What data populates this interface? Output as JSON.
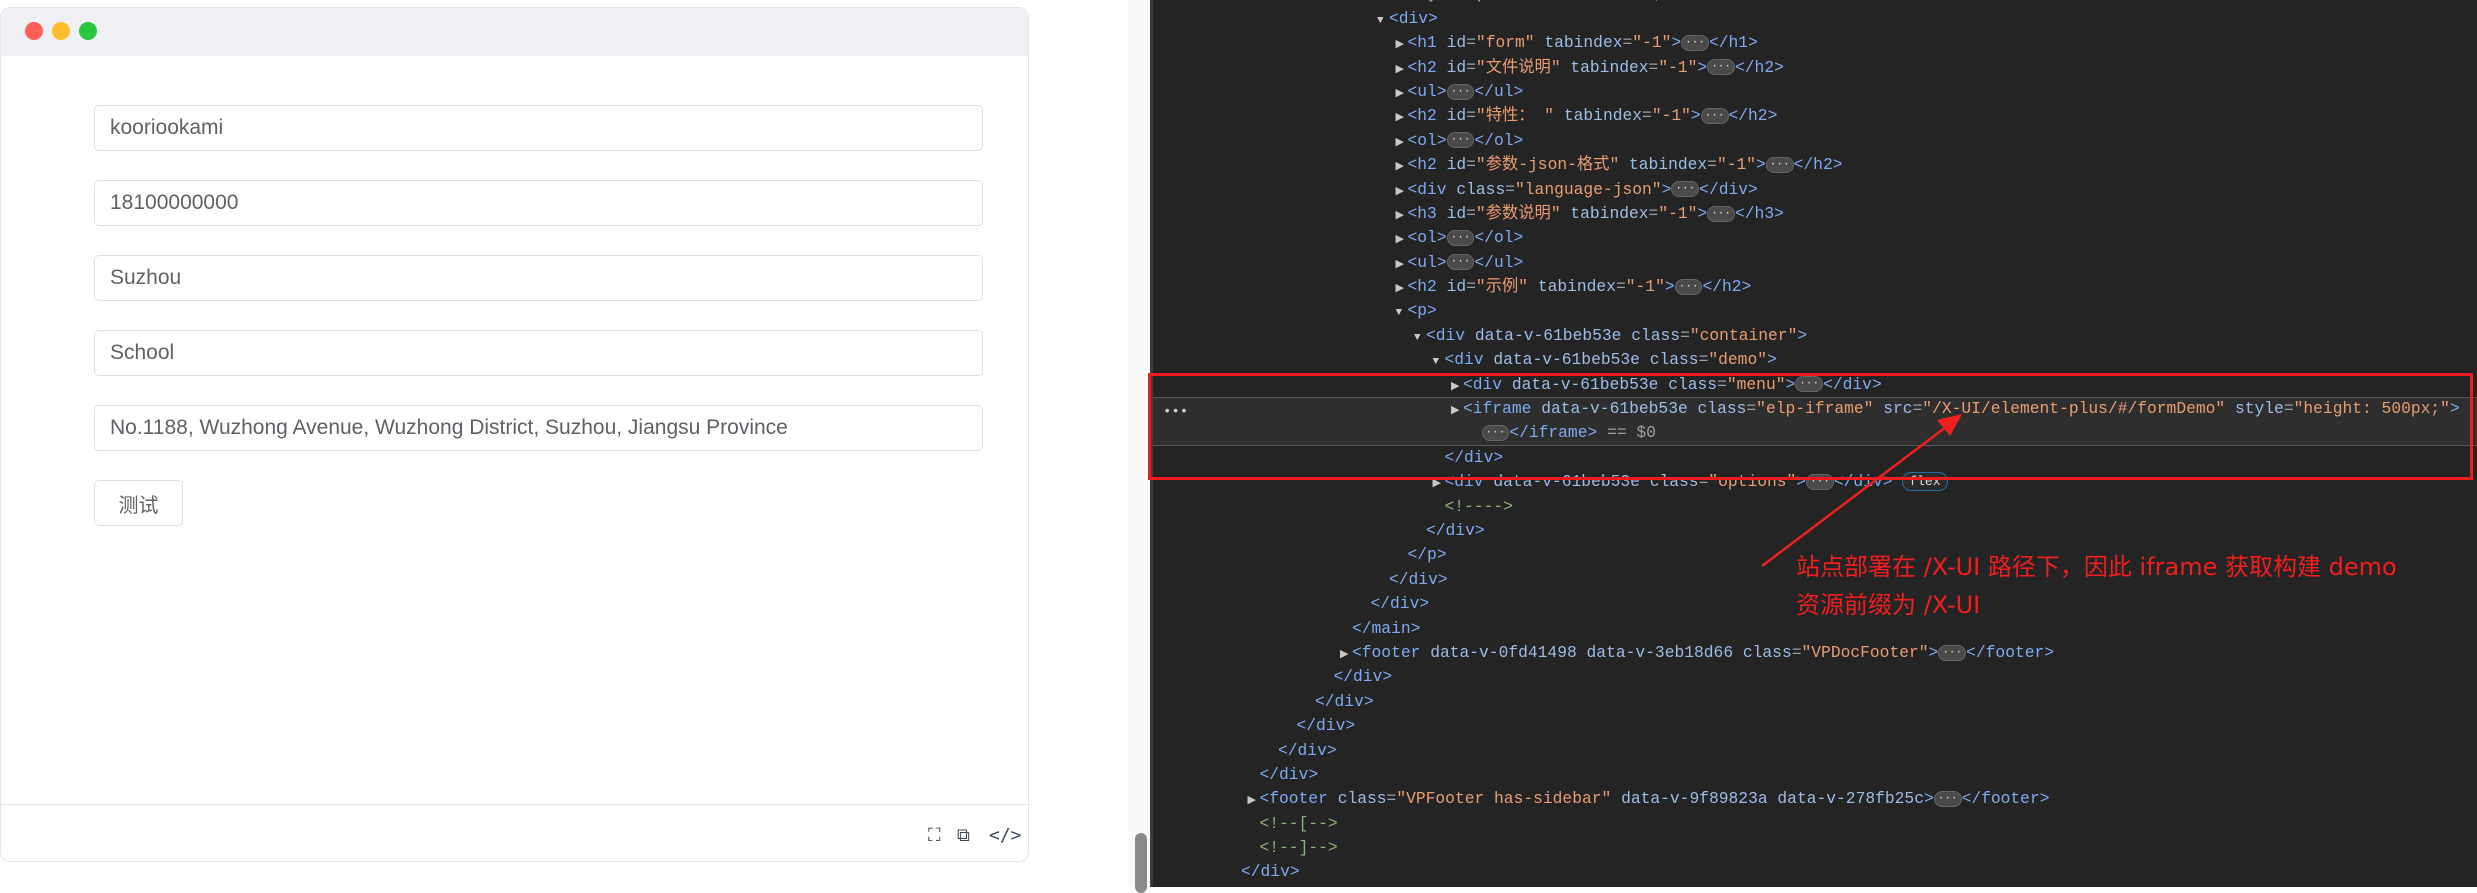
{
  "window": {
    "traffic_lights": [
      "#ff5f57",
      "#febc2e",
      "#28c840"
    ]
  },
  "form": {
    "fields": [
      {
        "value": "kooriookami"
      },
      {
        "value": "18100000000"
      },
      {
        "value": "Suzhou"
      },
      {
        "value": "School"
      },
      {
        "value": "No.1188, Wuzhong Avenue, Wuzhong District, Suzhou, Jiangsu Province"
      }
    ],
    "submit_label": "测试"
  },
  "demo_footer": {
    "icons": [
      "fullscreen-icon",
      "copy-icon",
      "code-icon"
    ],
    "code_label": "</>"
  },
  "devtools": {
    "selected_line_suffix": "== $0",
    "lines": [
      {
        "depth": 8,
        "arrow": "",
        "text": "<  style=\"position: relative;\">"
      },
      {
        "depth": 8,
        "arrow": "down",
        "text": "<div>"
      },
      {
        "depth": 9,
        "arrow": "right",
        "text": "<h1 id=\"form\" tabindex=\"-1\">⋯</h1>"
      },
      {
        "depth": 9,
        "arrow": "right",
        "text": "<h2 id=\"文件说明\" tabindex=\"-1\">⋯</h2>"
      },
      {
        "depth": 9,
        "arrow": "right",
        "text": "<ul>⋯</ul>"
      },
      {
        "depth": 9,
        "arrow": "right",
        "text": "<h2 id=\"特性： \" tabindex=\"-1\">⋯</h2>"
      },
      {
        "depth": 9,
        "arrow": "right",
        "text": "<ol>⋯</ol>"
      },
      {
        "depth": 9,
        "arrow": "right",
        "text": "<h2 id=\"参数-json-格式\" tabindex=\"-1\">⋯</h2>"
      },
      {
        "depth": 9,
        "arrow": "right",
        "text": "<div class=\"language-json\">⋯</div>"
      },
      {
        "depth": 9,
        "arrow": "right",
        "text": "<h3 id=\"参数说明\" tabindex=\"-1\">⋯</h3>"
      },
      {
        "depth": 9,
        "arrow": "right",
        "text": "<ol>⋯</ol>"
      },
      {
        "depth": 9,
        "arrow": "right",
        "text": "<ul>⋯</ul>"
      },
      {
        "depth": 9,
        "arrow": "right",
        "text": "<h2 id=\"示例\" tabindex=\"-1\">⋯</h2>"
      },
      {
        "depth": 9,
        "arrow": "down",
        "text": "<p>"
      },
      {
        "depth": 10,
        "arrow": "down",
        "text": "<div data-v-61beb53e class=\"container\">"
      },
      {
        "depth": 11,
        "arrow": "down",
        "text": "<div data-v-61beb53e class=\"demo\">"
      },
      {
        "depth": 12,
        "arrow": "right",
        "text": "<div data-v-61beb53e class=\"menu\">⋯</div>"
      },
      {
        "depth": 12,
        "arrow": "right",
        "text": "<iframe data-v-61beb53e class=\"elp-iframe\" src=\"/X-UI/element-plus/#/formDemo\" style=\"height: 500px;\">",
        "selected": true
      },
      {
        "depth": 13,
        "arrow": "",
        "text": "⋯</iframe> == $0",
        "selected": true
      },
      {
        "depth": 11,
        "arrow": "",
        "text": "</div>"
      },
      {
        "depth": 11,
        "arrow": "right",
        "text": "<div data-v-61beb53e class=\"options\">⋯</div> [flex]"
      },
      {
        "depth": 11,
        "arrow": "",
        "text": "<!---->"
      },
      {
        "depth": 10,
        "arrow": "",
        "text": "</div>"
      },
      {
        "depth": 9,
        "arrow": "",
        "text": "</p>"
      },
      {
        "depth": 8,
        "arrow": "",
        "text": "</div>"
      },
      {
        "depth": 7,
        "arrow": "",
        "text": "</div>"
      },
      {
        "depth": 6,
        "arrow": "",
        "text": "</main>"
      },
      {
        "depth": 6,
        "arrow": "right",
        "text": "<footer data-v-0fd41498 data-v-3eb18d66 class=\"VPDocFooter\">⋯</footer>"
      },
      {
        "depth": 5,
        "arrow": "",
        "text": "</div>"
      },
      {
        "depth": 4,
        "arrow": "",
        "text": "</div>"
      },
      {
        "depth": 3,
        "arrow": "",
        "text": "</div>"
      },
      {
        "depth": 2,
        "arrow": "",
        "text": "</div>"
      },
      {
        "depth": 1,
        "arrow": "",
        "text": "</div>"
      },
      {
        "depth": 1,
        "arrow": "right",
        "text": "<footer class=\"VPFooter has-sidebar\" data-v-9f89823a data-v-278fb25c>⋯</footer>"
      },
      {
        "depth": 1,
        "arrow": "",
        "text": "<!--[-->"
      },
      {
        "depth": 1,
        "arrow": "",
        "text": "<!--]-->"
      },
      {
        "depth": 0,
        "arrow": "",
        "text": "</div>"
      }
    ]
  },
  "annotation": {
    "text": "站点部署在 /X-UI 路径下，因此 iframe 获取构建 demo\n资源前缀为 /X-UI",
    "color": "#f01e1e"
  }
}
